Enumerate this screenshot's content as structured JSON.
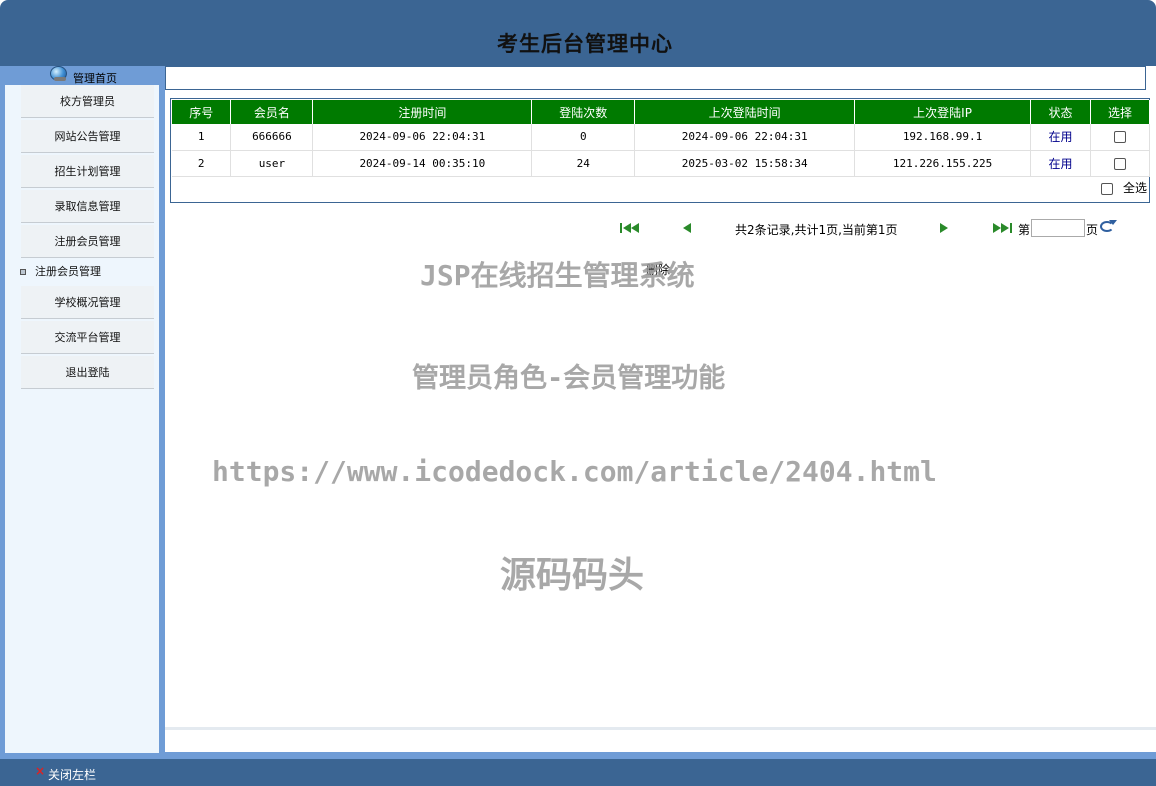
{
  "header": {
    "title": "考生后台管理中心"
  },
  "sidebar": {
    "home_label": "管理首页",
    "items": [
      {
        "label": "校方管理员"
      },
      {
        "label": "网站公告管理"
      },
      {
        "label": "招生计划管理"
      },
      {
        "label": "录取信息管理"
      },
      {
        "label": "注册会员管理"
      }
    ],
    "sub_item": {
      "label": "注册会员管理"
    },
    "items2": [
      {
        "label": "学校概况管理"
      },
      {
        "label": "交流平台管理"
      },
      {
        "label": "退出登陆"
      }
    ]
  },
  "table": {
    "headers": [
      "序号",
      "会员名",
      "注册时间",
      "登陆次数",
      "上次登陆时间",
      "上次登陆IP",
      "状态",
      "选择"
    ],
    "rows": [
      {
        "idx": "1",
        "name": "666666",
        "reg_time": "2024-09-06 22:04:31",
        "login_count": "0",
        "last_login": "2024-09-06 22:04:31",
        "last_ip": "192.168.99.1",
        "status": "在用"
      },
      {
        "idx": "2",
        "name": "user",
        "reg_time": "2024-09-14 00:35:10",
        "login_count": "24",
        "last_login": "2025-03-02 15:58:34",
        "last_ip": "121.226.155.225",
        "status": "在用"
      }
    ],
    "select_all_label": "全选"
  },
  "pager": {
    "summary": "共2条记录,共计1页,当前第1页",
    "page_prefix": "第",
    "page_suffix": "页",
    "page_input_value": ""
  },
  "actions": {
    "delete_label": "删除"
  },
  "watermarks": {
    "line1": "JSP在线招生管理系统",
    "line2": "管理员角色-会员管理功能",
    "line3": "https://www.icodedock.com/article/2404.html",
    "line4": "源码码头"
  },
  "footer": {
    "close_label": "关闭左栏"
  },
  "colors": {
    "header_bg": "#3b6593",
    "table_header_bg": "#007a00",
    "sidebar_frame": "#6f9cd6"
  }
}
